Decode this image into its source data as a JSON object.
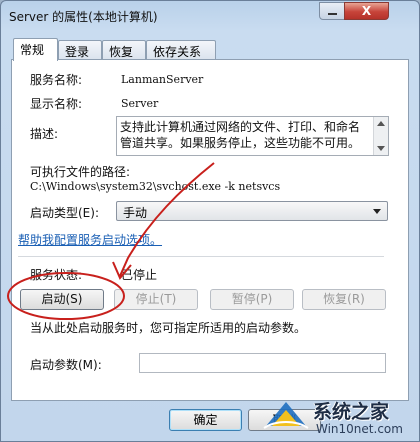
{
  "window": {
    "title": "Server 的属性(本地计算机)",
    "close_glyph": "X"
  },
  "tabs": [
    {
      "label": "常规",
      "active": true
    },
    {
      "label": "登录",
      "active": false
    },
    {
      "label": "恢复",
      "active": false
    },
    {
      "label": "依存关系",
      "active": false
    }
  ],
  "general": {
    "service_name_label": "服务名称:",
    "service_name": "LanmanServer",
    "display_name_label": "显示名称:",
    "display_name": "Server",
    "description_label": "描述:",
    "description": "支持此计算机通过网络的文件、打印、和命名管道共享。如果服务停止，这些功能不可用。",
    "path_label": "可执行文件的路径:",
    "path": "C:\\Windows\\system32\\svchost.exe -k netsvcs",
    "startup_type_label": "启动类型(E):",
    "startup_type": "手动",
    "help_link": "帮助我配置服务启动选项。",
    "status_label": "服务状态:",
    "status": "已停止",
    "buttons": {
      "start": "启动(S)",
      "stop": "停止(T)",
      "pause": "暂停(P)",
      "resume": "恢复(R)"
    },
    "hint": "当从此处启动服务时，您可指定所适用的启动参数。",
    "params_label": "启动参数(M):",
    "params_value": ""
  },
  "footer": {
    "ok": "确定",
    "cancel": "取消"
  },
  "watermark": {
    "title": "系统之家",
    "url": "Win10net.com"
  },
  "colors": {
    "annotation_red": "#c8201c",
    "link": "#1a5fb4"
  }
}
